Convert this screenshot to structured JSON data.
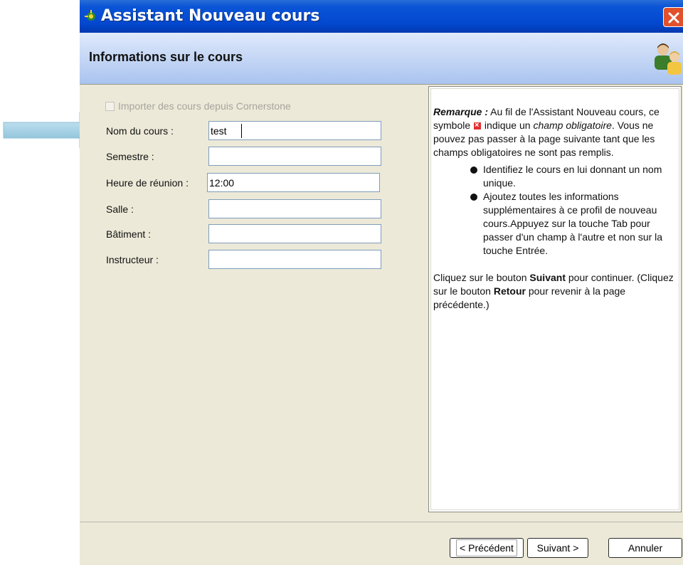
{
  "window": {
    "title": "Assistant Nouveau cours"
  },
  "header": {
    "title": "Informations sur le cours"
  },
  "form": {
    "import_checkbox": {
      "label": "Importer des cours depuis Cornerstone",
      "checked": false,
      "enabled": false
    },
    "fields": [
      {
        "label": "Nom du cours :",
        "value": "test",
        "placeholder": ""
      },
      {
        "label": "Semestre :",
        "value": "",
        "placeholder": ""
      },
      {
        "label": "Heure de réunion :",
        "value": "12:00",
        "placeholder": ""
      },
      {
        "label": "Salle :",
        "value": "",
        "placeholder": ""
      },
      {
        "label": "Bâtiment :",
        "value": "",
        "placeholder": ""
      },
      {
        "label": "Instructeur :",
        "value": "",
        "placeholder": ""
      }
    ]
  },
  "help": {
    "remark_label": "Remarque :",
    "p1_a": " Au fil de l'Assistant Nouveau cours, ce symbole ",
    "p1_b": " indique un ",
    "p1_italic": "champ obligatoire",
    "p1_c": ". Vous ne pouvez pas passer à la page suivante tant que les champs obligatoires ne sont pas remplis.",
    "bullets": [
      "Identifiez le cours en lui donnant un nom unique.",
      "Ajoutez toutes les informations supplémentaires à ce profil de nouveau cours.Appuyez sur la touche Tab pour passer d'un champ à l'autre et non sur la touche Entrée."
    ],
    "p2_a": "Cliquez sur le bouton ",
    "p2_bold1": "Suivant",
    "p2_b": " pour continuer. (Cliquez sur le bouton ",
    "p2_bold2": "Retour",
    "p2_c": " pour revenir à la page précédente.)"
  },
  "buttons": {
    "previous": "< Précédent",
    "next": "Suivant >",
    "cancel": "Annuler"
  },
  "colors": {
    "titlebar": "#0349d0",
    "header_gradient_top": "#dfe9fb",
    "header_gradient_bottom": "#aac4ef",
    "background": "#ece9d8",
    "close": "#e0512c",
    "annotation_arrow": "#a6cfe3"
  }
}
